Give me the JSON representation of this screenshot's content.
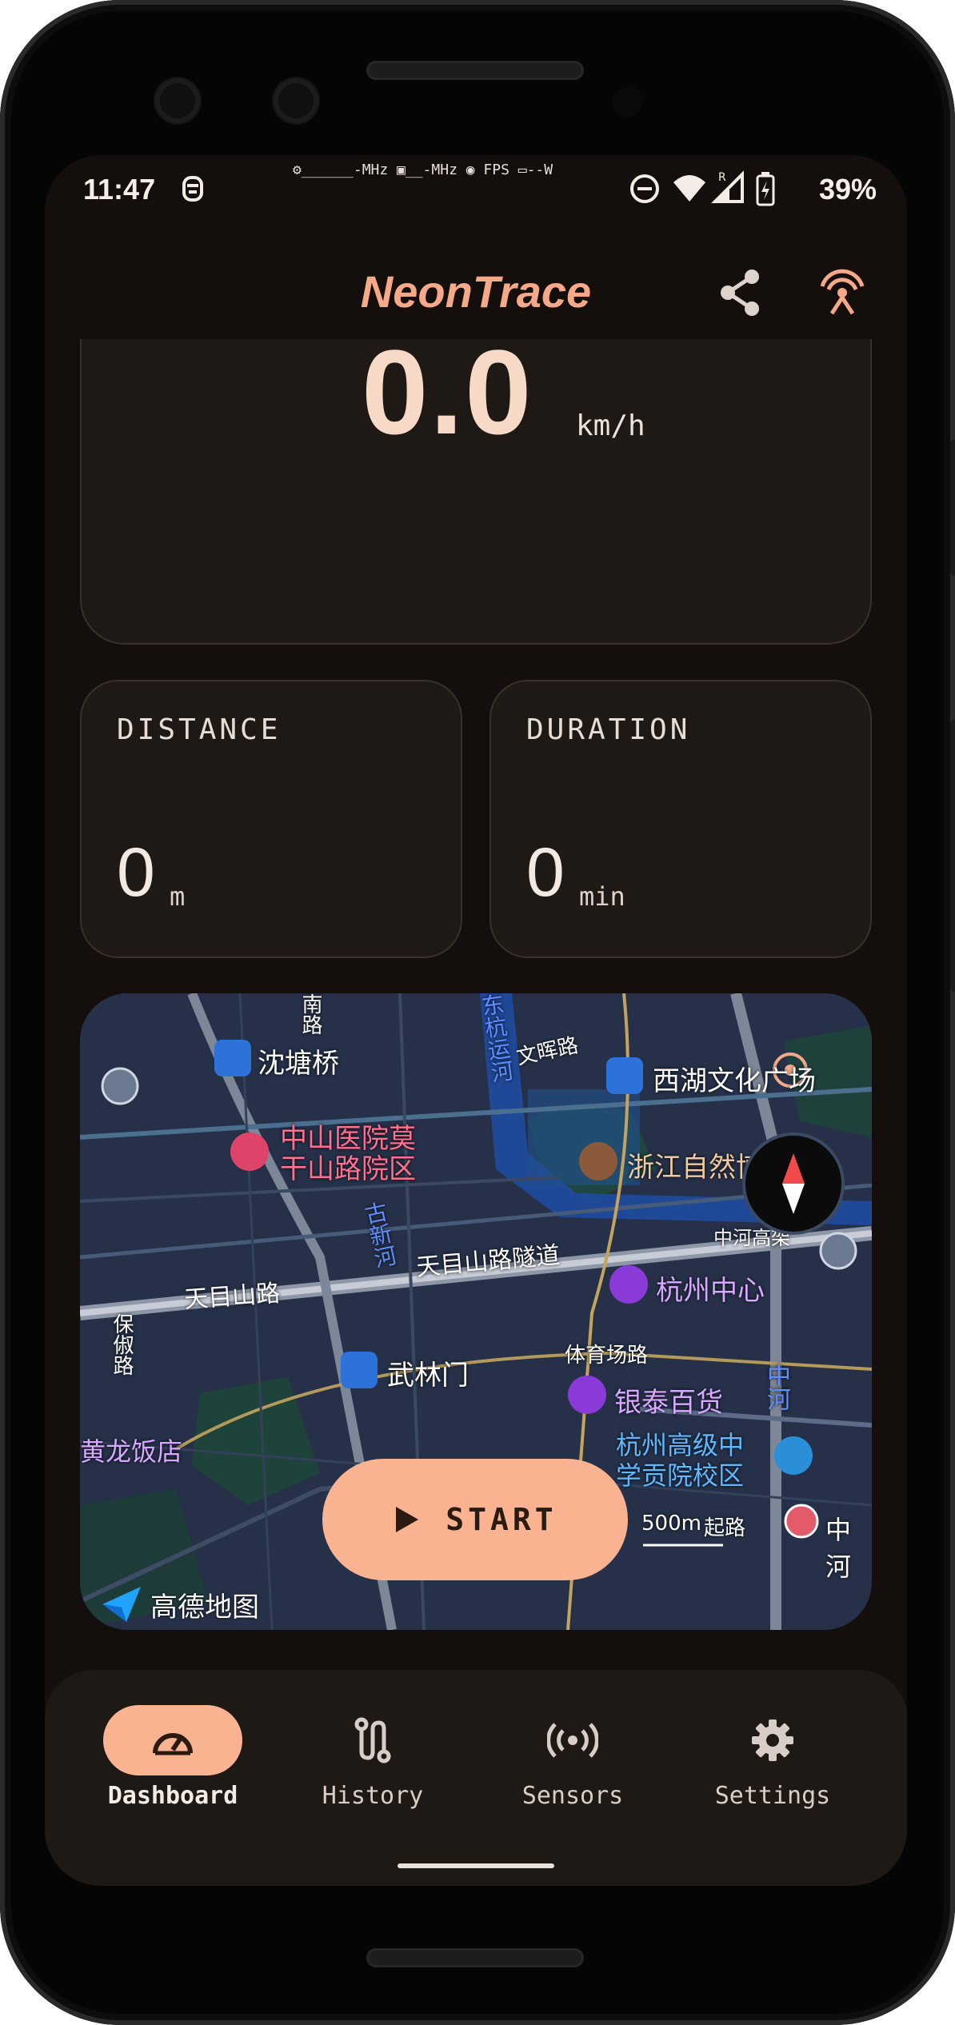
{
  "status_bar": {
    "time": "11:47",
    "perf_overlay": "⚙______-MHz ▣__-MHz ◉ FPS  ▭--W",
    "battery_percent": "39%"
  },
  "app_bar": {
    "title": "NeonTrace",
    "share_icon": "share-icon",
    "broadcast_icon": "broadcast-icon"
  },
  "speed": {
    "value": "0.0",
    "unit": "km/h"
  },
  "distance": {
    "label": "DISTANCE",
    "value": "0",
    "unit": "m"
  },
  "duration": {
    "label": "DURATION",
    "value": "0",
    "unit": "min"
  },
  "map": {
    "labels": [
      "沈塘桥",
      "中山医院莫",
      "干山路院区",
      "西湖文化广场",
      "浙江自然博物院",
      "天目山路",
      "天目山路隧道",
      "杭州中心",
      "武林门",
      "体育场路",
      "银泰百货",
      "杭州高级中",
      "学贡院校区",
      "古新河",
      "东杭运河",
      "文晖路",
      "保俶路",
      "黄龙饭店",
      "中河高架",
      "中河",
      "中河",
      "起路",
      "南路"
    ],
    "scale": "500m",
    "brand": "高德地图",
    "start_label": "START"
  },
  "nav": {
    "items": [
      {
        "label": "Dashboard",
        "icon": "speedometer-icon",
        "active": true
      },
      {
        "label": "History",
        "icon": "route-icon",
        "active": false
      },
      {
        "label": "Sensors",
        "icon": "sensors-icon",
        "active": false
      },
      {
        "label": "Settings",
        "icon": "gear-icon",
        "active": false
      }
    ]
  },
  "colors": {
    "accent": "#f9b391",
    "title": "#f6a988",
    "background": "#140f0c",
    "card": "#1f1916"
  }
}
